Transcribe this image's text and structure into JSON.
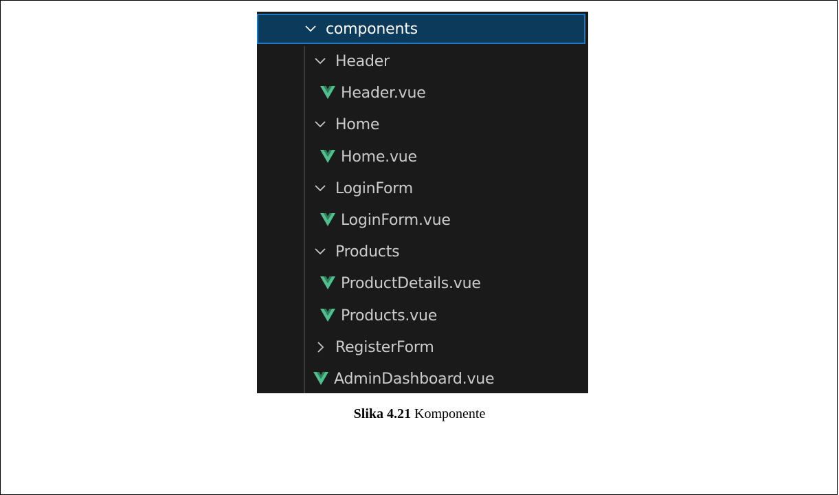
{
  "explorer": {
    "root": {
      "label": "components",
      "expanded": true
    },
    "items": [
      {
        "label": "Header",
        "type": "folder",
        "expanded": true,
        "depth": 0
      },
      {
        "label": "Header.vue",
        "type": "vue-file",
        "depth": 1
      },
      {
        "label": "Home",
        "type": "folder",
        "expanded": true,
        "depth": 0
      },
      {
        "label": "Home.vue",
        "type": "vue-file",
        "depth": 1
      },
      {
        "label": "LoginForm",
        "type": "folder",
        "expanded": true,
        "depth": 0
      },
      {
        "label": "LoginForm.vue",
        "type": "vue-file",
        "depth": 1
      },
      {
        "label": "Products",
        "type": "folder",
        "expanded": true,
        "depth": 0
      },
      {
        "label": "ProductDetails.vue",
        "type": "vue-file",
        "depth": 1
      },
      {
        "label": "Products.vue",
        "type": "vue-file",
        "depth": 1
      },
      {
        "label": "RegisterForm",
        "type": "folder",
        "expanded": false,
        "depth": 0
      },
      {
        "label": "AdminDashboard.vue",
        "type": "vue-file",
        "depth": 0
      }
    ]
  },
  "caption": {
    "number": "Slika 4.21",
    "text": "Komponente"
  },
  "colors": {
    "panel_bg": "#1a1a1a",
    "selected_bg": "#0b3a5a",
    "selected_border": "#1f78c4",
    "vue_green": "#4fc08d"
  }
}
